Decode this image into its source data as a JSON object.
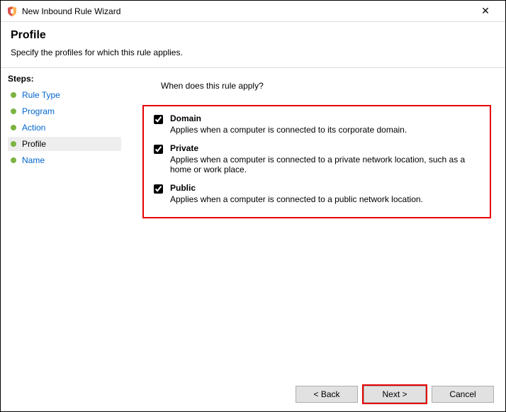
{
  "window": {
    "title": "New Inbound Rule Wizard"
  },
  "header": {
    "title": "Profile",
    "subtitle": "Specify the profiles for which this rule applies."
  },
  "sidebar": {
    "label": "Steps:",
    "items": [
      {
        "label": "Rule Type"
      },
      {
        "label": "Program"
      },
      {
        "label": "Action"
      },
      {
        "label": "Profile"
      },
      {
        "label": "Name"
      }
    ],
    "active_index": 3
  },
  "main": {
    "prompt": "When does this rule apply?",
    "options": [
      {
        "name": "Domain",
        "desc": "Applies when a computer is connected to its corporate domain.",
        "checked": true
      },
      {
        "name": "Private",
        "desc": "Applies when a computer is connected to a private network location, such as a home or work place.",
        "checked": true
      },
      {
        "name": "Public",
        "desc": "Applies when a computer is connected to a public network location.",
        "checked": true
      }
    ]
  },
  "footer": {
    "back": "< Back",
    "next": "Next >",
    "cancel": "Cancel"
  }
}
